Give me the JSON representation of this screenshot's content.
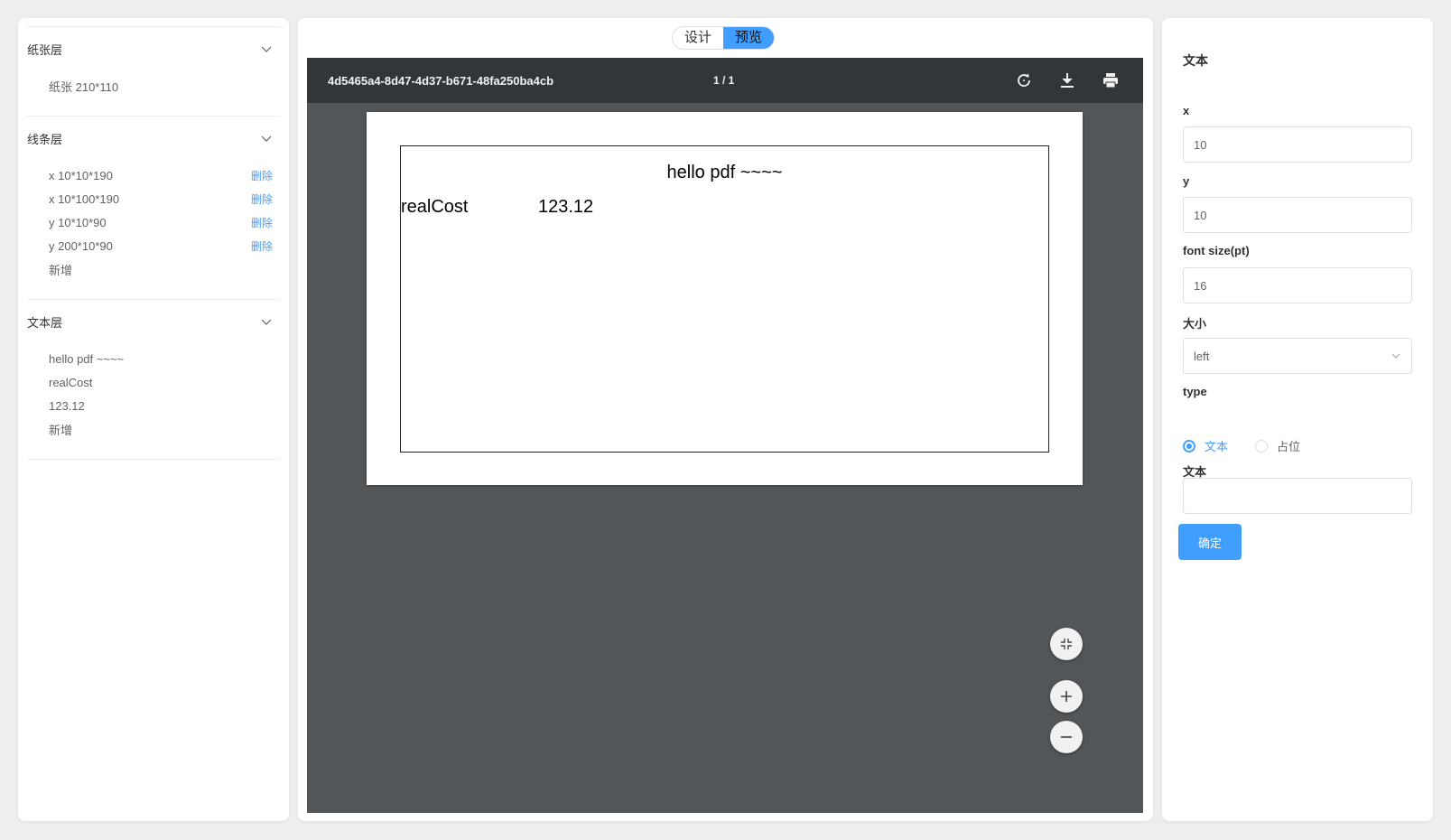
{
  "left": {
    "sections": [
      {
        "title": "纸张层",
        "items": [
          {
            "label": "纸张 210*110",
            "action": ""
          }
        ]
      },
      {
        "title": "线条层",
        "items": [
          {
            "label": "x 10*10*190",
            "action": "删除"
          },
          {
            "label": "x 10*100*190",
            "action": "删除"
          },
          {
            "label": "y 10*10*90",
            "action": "删除"
          },
          {
            "label": "y 200*10*90",
            "action": "删除"
          },
          {
            "label": "新增",
            "action": ""
          }
        ]
      },
      {
        "title": "文本层",
        "items": [
          {
            "label": "hello pdf ~~~~",
            "action": ""
          },
          {
            "label": "realCost",
            "action": ""
          },
          {
            "label": "123.12",
            "action": ""
          },
          {
            "label": "新增",
            "action": ""
          }
        ]
      }
    ]
  },
  "center": {
    "mode_toggle": {
      "design": "设计",
      "preview": "预览",
      "active": "preview"
    },
    "viewer": {
      "doc_title": "4d5465a4-8d47-4d37-b671-48fa250ba4cb",
      "page_info": "1 / 1",
      "icons": [
        "rotate-icon",
        "download-icon",
        "print-icon"
      ],
      "page": {
        "title": "hello pdf ~~~~",
        "label": "realCost",
        "value": "123.12"
      },
      "controls": [
        "fit-page-icon",
        "zoom-in-icon",
        "zoom-out-icon"
      ]
    }
  },
  "right": {
    "title": "文本",
    "x_label": "x",
    "x_value": "10",
    "y_label": "y",
    "y_value": "10",
    "font_size_label": "font size(pt)",
    "font_size_value": "16",
    "align_label": "大小",
    "align_value": "left",
    "type_label": "type",
    "type_options": [
      "文本",
      "占位"
    ],
    "type_selected": "文本",
    "text_label": "文本",
    "text_value": "",
    "confirm_label": "确定"
  },
  "colors": {
    "accent": "#409eff",
    "viewer_bg": "#525659",
    "toolbar_bg": "#323639"
  }
}
